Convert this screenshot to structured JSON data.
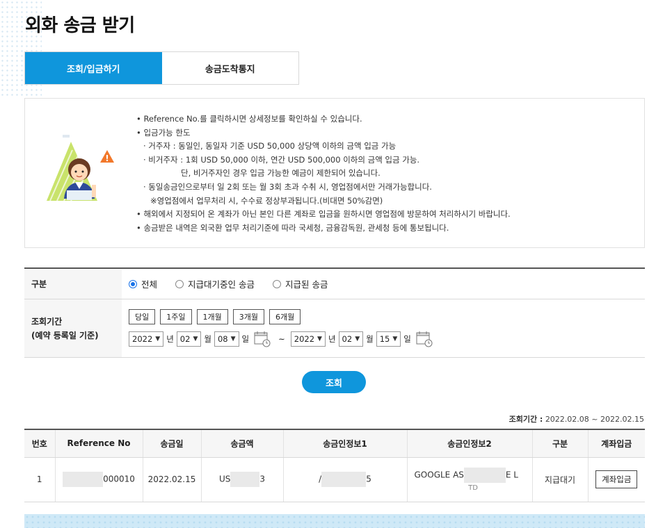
{
  "page": {
    "title": "외화 송금 받기"
  },
  "tabs": [
    {
      "label": "조회/입금하기",
      "active": true
    },
    {
      "label": "송금도착통지",
      "active": false
    }
  ],
  "notice": {
    "lines": [
      "• Reference No.를 클릭하시면 상세정보를 확인하실 수 있습니다.",
      "• 입금가능 한도",
      "· 거주자 : 동일인, 동일자 기준 USD 50,000 상당액 이하의 금액 입금 가능",
      "· 비거주자 : 1회 USD 50,000 이하, 연간 USD 500,000 이하의 금액 입금 가능.",
      "단, 비거주자인 경우 입금 가능한 예금이 제한되어 있습니다.",
      "· 동일송금인으로부터 일 2회 또는 월 3회 초과 수취 시, 영업점에서만 거래가능합니다.",
      "※영업점에서 업무처리 시, 수수료 정상부과됩니다.(비대면 50%감면)",
      "• 해외에서 지정되어 온 계좌가 아닌 본인 다른 계좌로 입금을 원하시면 영업점에 방문하여 처리하시기 바랍니다.",
      "• 송금받은 내역은 외국환 업무 처리기준에 따라 국세청, 금융감독원, 관세청 등에 통보됩니다."
    ]
  },
  "filter": {
    "category_label": "구분",
    "options": [
      {
        "label": "전체",
        "selected": true
      },
      {
        "label": "지급대기중인 송금",
        "selected": false
      },
      {
        "label": "지급된 송금",
        "selected": false
      }
    ],
    "period_label": "조회기간",
    "period_sub": "(예약 등록일 기준)",
    "period_buttons": [
      "당일",
      "1주일",
      "1개월",
      "3개월",
      "6개월"
    ],
    "start": {
      "year": "2022",
      "month": "02",
      "day": "08"
    },
    "end": {
      "year": "2022",
      "month": "02",
      "day": "15"
    },
    "year_unit": "년",
    "month_unit": "월",
    "day_unit": "일",
    "tilde": "~"
  },
  "search_button": "조회",
  "period_display": {
    "label": "조회기간 :",
    "value": "2022.02.08 ~ 2022.02.15"
  },
  "table": {
    "headers": [
      "번호",
      "Reference No",
      "송금일",
      "송금액",
      "송금인정보1",
      "송금인정보2",
      "구분",
      "계좌입금"
    ],
    "rows": [
      {
        "no": "1",
        "ref_suffix": "000010",
        "date": "2022.02.15",
        "amount_prefix": "US",
        "amount_suffix": "3",
        "info1_prefix": "/",
        "info1_suffix": "5",
        "info2_prefix": "GOOGLE AS",
        "info2_suffix": "E L",
        "info2_line2": "TD",
        "status": "지급대기",
        "action": "계좌입금"
      }
    ]
  },
  "colors": {
    "accent": "#0f96dc",
    "header_bg": "#f6f6f6"
  }
}
